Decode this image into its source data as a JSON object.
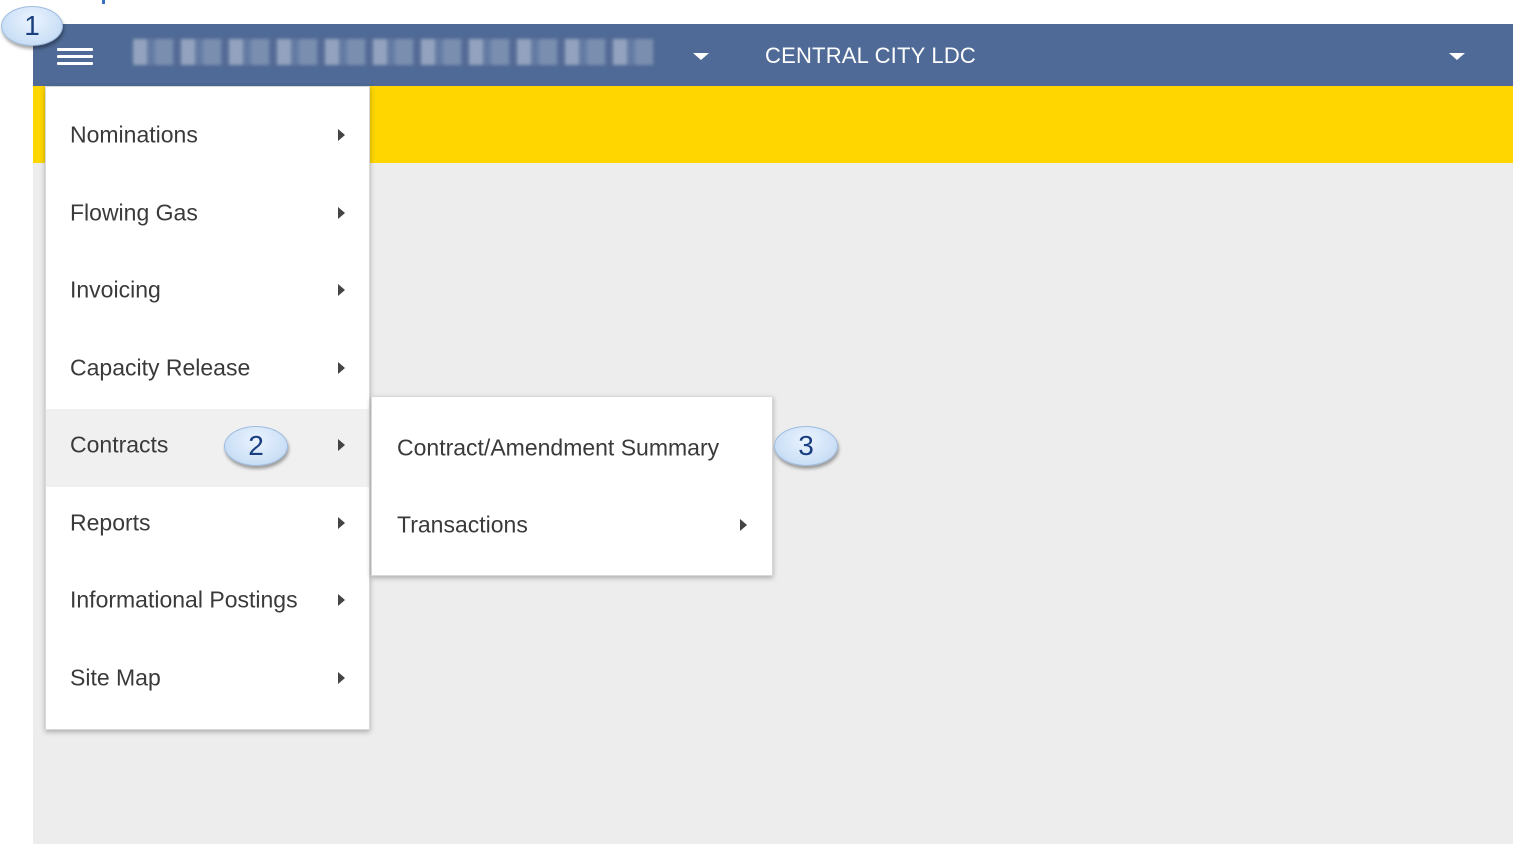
{
  "header": {
    "org_name": "CENTRAL CITY LDC",
    "selector_value": ""
  },
  "menu": {
    "items": [
      {
        "label": "Nominations"
      },
      {
        "label": "Flowing Gas"
      },
      {
        "label": "Invoicing"
      },
      {
        "label": "Capacity Release"
      },
      {
        "label": "Contracts"
      },
      {
        "label": "Reports"
      },
      {
        "label": "Informational Postings"
      },
      {
        "label": "Site Map"
      }
    ]
  },
  "submenu": {
    "items": [
      {
        "label": "Contract/Amendment Summary"
      },
      {
        "label": "Transactions"
      }
    ]
  },
  "callouts": [
    "1",
    "2",
    "3"
  ],
  "icons": {
    "menu": "hamburger-menu-icon",
    "dropdown": "caret-down-icon",
    "submenu_arrow": "chevron-right-icon"
  },
  "colors": {
    "header": "#4f6a96",
    "banner": "#ffd600",
    "content_bg": "#ededed",
    "active_item": "#f0f0f0"
  }
}
